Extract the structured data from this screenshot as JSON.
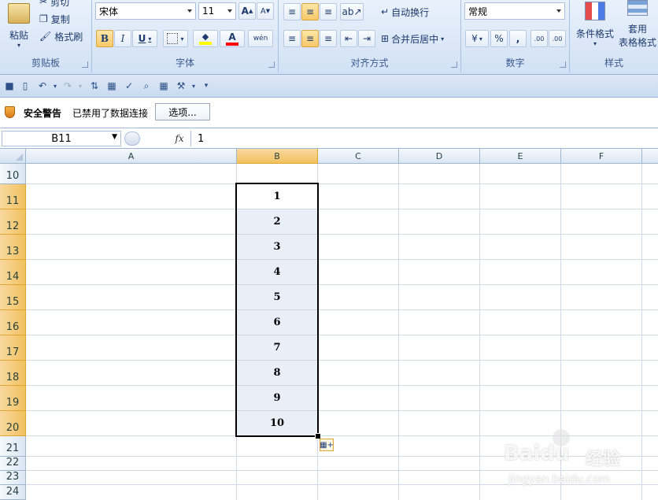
{
  "ribbon": {
    "clipboard": {
      "paste": "粘贴",
      "cut": "剪切",
      "copy": "复制",
      "format_painter": "格式刷",
      "label": "剪贴板"
    },
    "font": {
      "name": "宋体",
      "size": "11",
      "grow": "A",
      "shrink": "A",
      "bold": "B",
      "italic": "I",
      "underline": "U",
      "font_color": "A",
      "phonetic": "wén",
      "label": "字体"
    },
    "alignment": {
      "wrap": "自动换行",
      "merge": "合并后居中",
      "label": "对齐方式"
    },
    "number": {
      "format": "常规",
      "percent": "%",
      "comma": ",",
      "inc": ".00",
      "dec": ".00",
      "label": "数字"
    },
    "styles": {
      "cond": "条件格式",
      "table_1": "套用",
      "table_2": "表格格式",
      "label": "样式"
    }
  },
  "security": {
    "title": "安全警告",
    "message": "已禁用了数据连接",
    "options": "选项..."
  },
  "formula": {
    "cell_ref": "B11",
    "fx": "fx",
    "value": "1"
  },
  "columns": [
    "A",
    "B",
    "C",
    "D",
    "E",
    "F"
  ],
  "rows": [
    "10",
    "11",
    "12",
    "13",
    "14",
    "15",
    "16",
    "17",
    "18",
    "19",
    "20",
    "21",
    "22",
    "23",
    "24"
  ],
  "cells_b": [
    "1",
    "2",
    "3",
    "4",
    "5",
    "6",
    "7",
    "8",
    "9",
    "10"
  ],
  "watermark": {
    "brand": "Baidu",
    "jingyan": "经验",
    "url": "jingyan.baidu.com"
  }
}
